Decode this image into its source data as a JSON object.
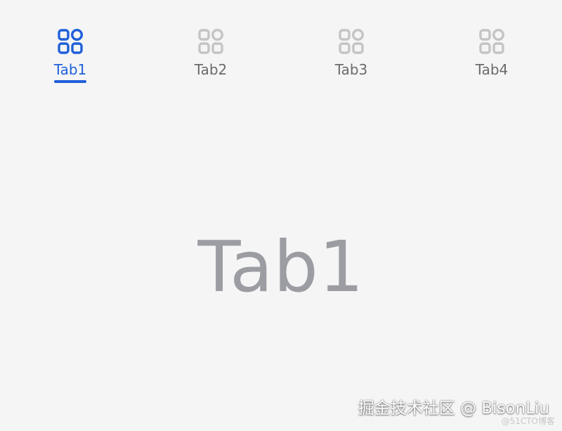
{
  "tabs": [
    {
      "label": "Tab1",
      "icon": "grid-icon",
      "active": true
    },
    {
      "label": "Tab2",
      "icon": "grid-icon",
      "active": false
    },
    {
      "label": "Tab3",
      "icon": "grid-icon",
      "active": false
    },
    {
      "label": "Tab4",
      "icon": "grid-icon",
      "active": false
    }
  ],
  "content": {
    "title": "Tab1"
  },
  "watermark": {
    "main": "掘金技术社区 @ BisonLiu",
    "sub": "@51CTO博客"
  },
  "colors": {
    "active": "#1f5fd9",
    "inactive_icon": "#c4c4c4",
    "inactive_label": "#6b6b6b",
    "content_text": "#9b9da2",
    "background": "#f5f5f5"
  }
}
